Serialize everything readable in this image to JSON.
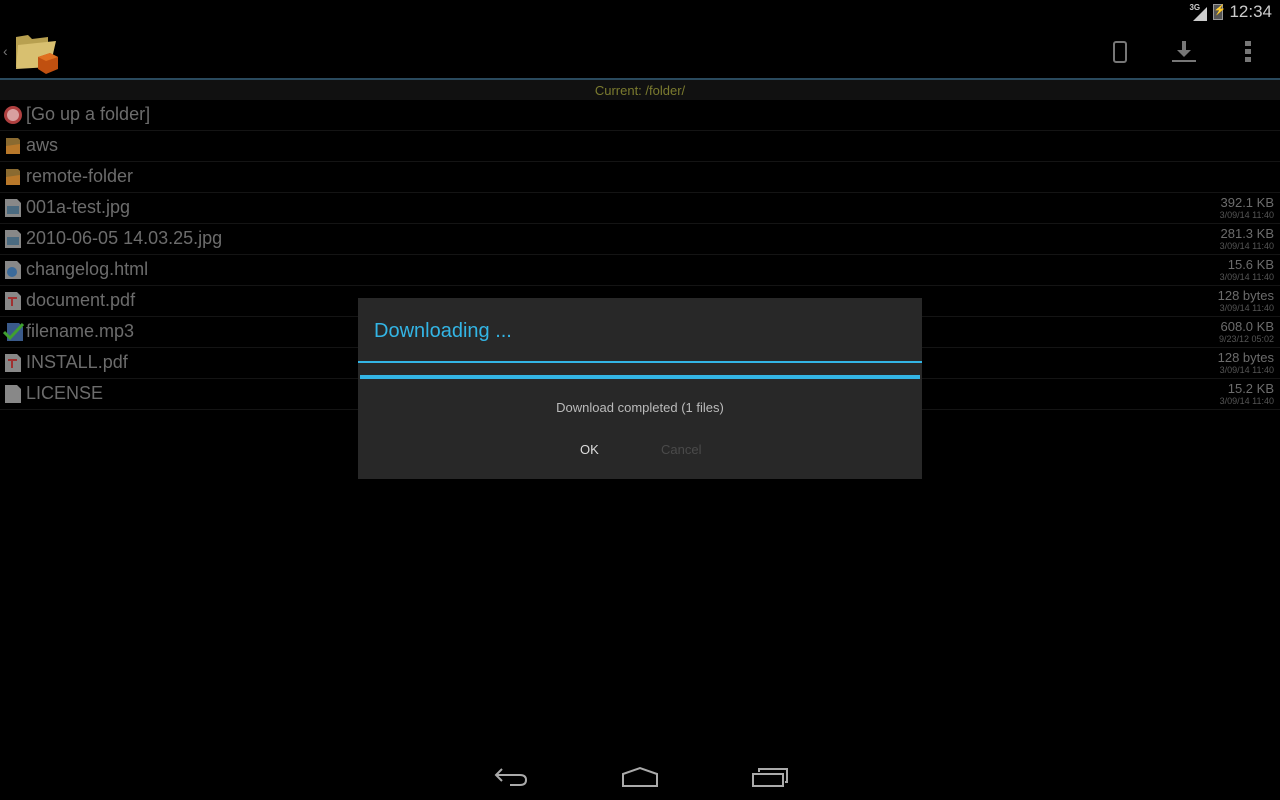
{
  "status_bar": {
    "network": "3G",
    "time": "12:34"
  },
  "action_bar": {
    "actions": [
      {
        "name": "local-device",
        "icon": "phone-icon"
      },
      {
        "name": "download",
        "icon": "download-icon"
      },
      {
        "name": "overflow-menu",
        "icon": "more-vert-icon"
      }
    ]
  },
  "current_path": "Current: /folder/",
  "files": [
    {
      "name": "[Go up a folder]",
      "type": "up",
      "size": "",
      "date": ""
    },
    {
      "name": "aws",
      "type": "folder",
      "size": "",
      "date": ""
    },
    {
      "name": "remote-folder",
      "type": "folder",
      "size": "",
      "date": ""
    },
    {
      "name": "001a-test.jpg",
      "type": "image",
      "size": "392.1 KB",
      "date": "3/09/14 11:40"
    },
    {
      "name": "2010-06-05 14.03.25.jpg",
      "type": "image",
      "size": "281.3 KB",
      "date": "3/09/14 11:40"
    },
    {
      "name": "changelog.html",
      "type": "html",
      "size": "15.6 KB",
      "date": "3/09/14 11:40"
    },
    {
      "name": "document.pdf",
      "type": "pdf",
      "size": "128 bytes",
      "date": "3/09/14 11:40"
    },
    {
      "name": "filename.mp3",
      "type": "checked",
      "size": "608.0 KB",
      "date": "9/23/12 05:02"
    },
    {
      "name": "INSTALL.pdf",
      "type": "pdf",
      "size": "128 bytes",
      "date": "3/09/14 11:40"
    },
    {
      "name": "LICENSE",
      "type": "file",
      "size": "15.2 KB",
      "date": "3/09/14 11:40"
    }
  ],
  "dialog": {
    "title": "Downloading ...",
    "progress_percent": 100,
    "message": "Download completed (1 files)",
    "ok_label": "OK",
    "cancel_label": "Cancel"
  },
  "colors": {
    "accent": "#33b5e5",
    "path_text": "#7b7b2f"
  }
}
